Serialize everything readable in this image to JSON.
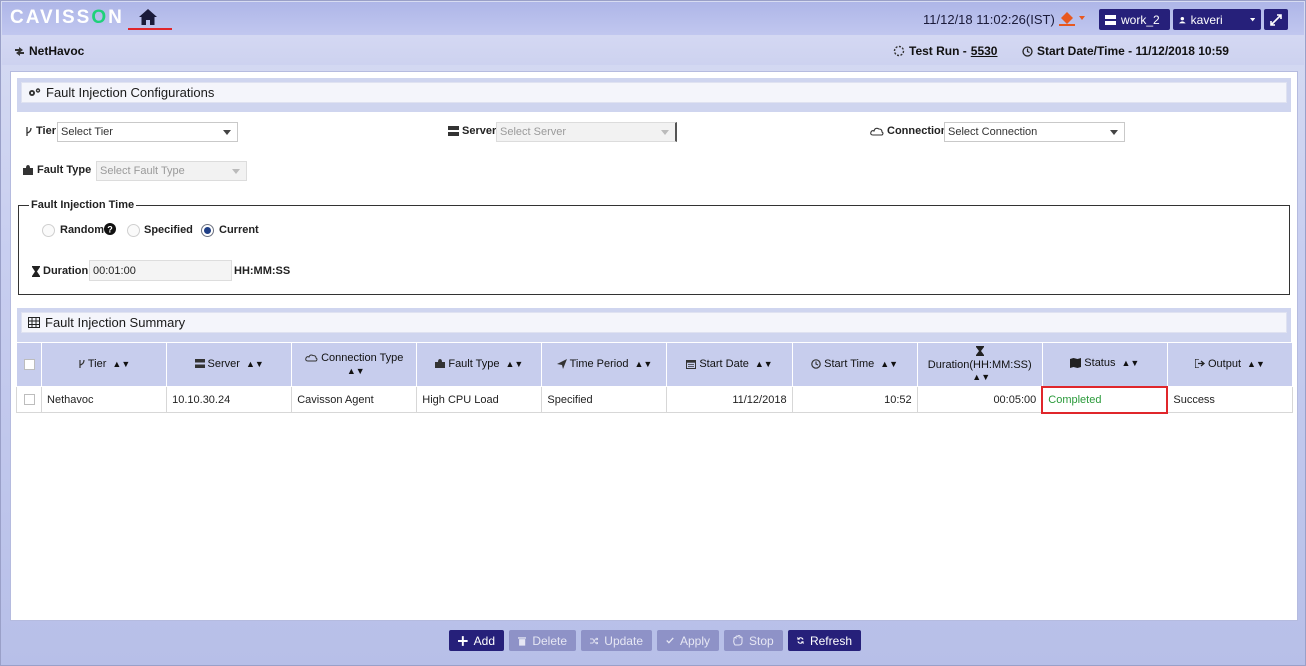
{
  "brand": {
    "logo_prefix": "CAVISS",
    "logo_o": "O",
    "logo_suffix": "N"
  },
  "header": {
    "datetime": "11/12/18 11:02:26(IST)",
    "workspace": "work_2",
    "user": "kaveri",
    "accent_color": "#26207a"
  },
  "subheader": {
    "app_name": "NetHavoc",
    "test_run_label": "Test Run -",
    "test_run_value": "5530",
    "start_label": "Start Date/Time - 11/12/2018 10:59"
  },
  "config": {
    "title": "Fault Injection Configurations",
    "tier_label": "Tier",
    "tier_value": "Select Tier",
    "server_label": "Server",
    "server_value": "Select Server",
    "connection_label": "Connection",
    "connection_value": "Select Connection",
    "fault_type_label": "Fault Type",
    "fault_type_value": "Select Fault Type",
    "time_legend": "Fault Injection Time",
    "random_label": "Random",
    "specified_label": "Specified",
    "current_label": "Current",
    "selected_mode": "Current",
    "duration_label": "Duration",
    "duration_value": "00:01:00",
    "duration_unit": "HH:MM:SS"
  },
  "summary": {
    "title": "Fault Injection Summary",
    "columns": [
      "Tier",
      "Server",
      "Connection Type",
      "Fault Type",
      "Time Period",
      "Start Date",
      "Start Time",
      "Duration(HH:MM:SS)",
      "Status",
      "Output"
    ],
    "rows": [
      [
        "Nethavoc",
        "10.10.30.24",
        "Cavisson Agent",
        "High CPU Load",
        "Specified",
        "11/12/2018",
        "10:52",
        "00:05:00",
        "Completed",
        "Success"
      ]
    ],
    "status_color": "#2a9a3a"
  },
  "actions": {
    "add": "Add",
    "delete": "Delete",
    "update": "Update",
    "apply": "Apply",
    "stop": "Stop",
    "refresh": "Refresh"
  }
}
